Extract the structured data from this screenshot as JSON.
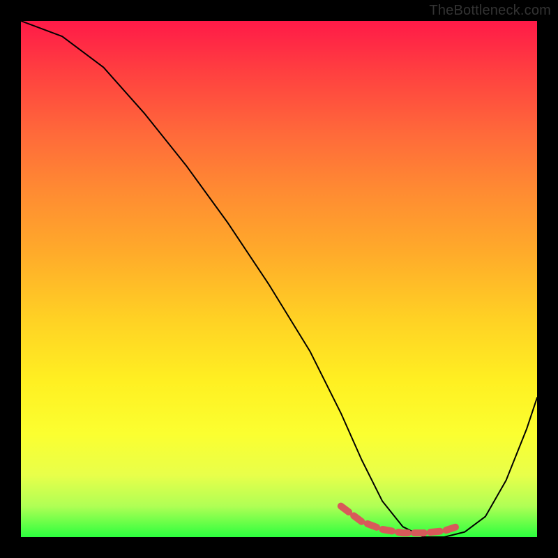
{
  "watermark": "TheBottleneck.com",
  "colors": {
    "background": "#000000",
    "curve": "#000000",
    "marker": "#d85a5a",
    "gradient_top": "#ff1a48",
    "gradient_bottom": "#2bff3e"
  },
  "chart_data": {
    "type": "line",
    "title": "",
    "xlabel": "",
    "ylabel": "",
    "xlim": [
      0,
      100
    ],
    "ylim": [
      0,
      100
    ],
    "series": [
      {
        "name": "bottleneck-curve",
        "x": [
          0,
          8,
          16,
          24,
          32,
          40,
          48,
          56,
          62,
          66,
          70,
          74,
          78,
          82,
          86,
          90,
          94,
          98,
          100
        ],
        "values": [
          100,
          97,
          91,
          82,
          72,
          61,
          49,
          36,
          24,
          15,
          7,
          2,
          0,
          0,
          1,
          4,
          11,
          21,
          27
        ]
      }
    ],
    "highlighted_range": {
      "name": "optimal-zone",
      "x": [
        62,
        66,
        70,
        74,
        78,
        82,
        85
      ],
      "values": [
        6,
        3,
        1.5,
        0.8,
        0.8,
        1.2,
        2.2
      ]
    }
  }
}
